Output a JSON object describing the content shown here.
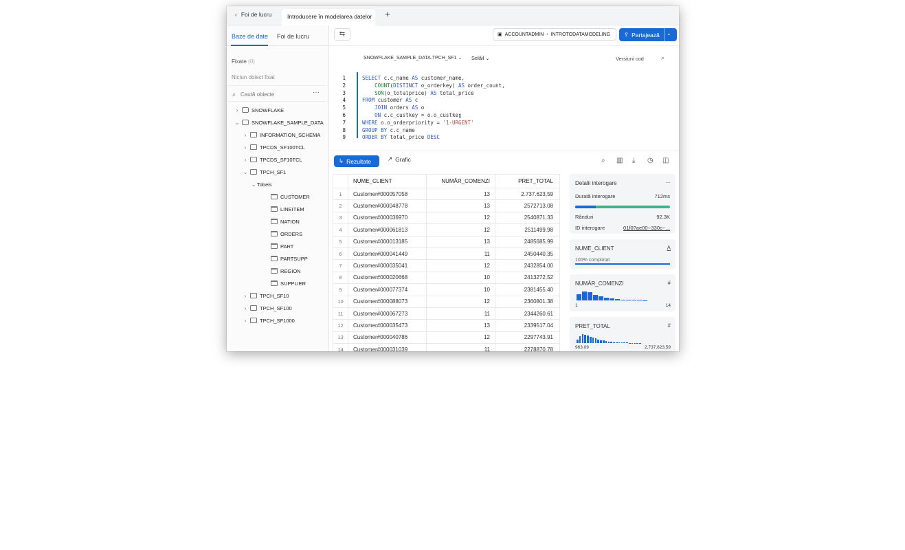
{
  "topbar": {
    "back_label": "Foi de lucru",
    "active_tab": "Introducere în modelarea datelor",
    "plus": "+"
  },
  "sidebar": {
    "tabs": [
      "Baze de date",
      "Foi de lucru"
    ],
    "pinned_label": "Fixate",
    "pinned_count": "(0)",
    "no_pinned": "Niciun obiect fixat",
    "search_placeholder": "Caută obiecte",
    "tree": [
      {
        "label": "SNOWFLAKE",
        "chev": "›",
        "icon": "db"
      },
      {
        "label": "SNOWFLAKE_SAMPLE_DATA",
        "chev": "⌄",
        "icon": "db"
      },
      {
        "label": "INFORMATION_SCHEMA",
        "chev": "›",
        "icon": "schema"
      },
      {
        "label": "TPCDS_SF100TCL",
        "chev": "›",
        "icon": "schema"
      },
      {
        "label": "TPCDS_SF10TCL",
        "chev": "›",
        "icon": "schema"
      },
      {
        "label": "TPCH_SF1",
        "chev": "⌄",
        "icon": "schema"
      },
      {
        "label": "Tobeis",
        "chev": "⌄",
        "icon": "none"
      },
      {
        "label": "CUSTOMER",
        "chev": "",
        "icon": "table"
      },
      {
        "label": "LINEITEM",
        "chev": "",
        "icon": "table"
      },
      {
        "label": "NATION",
        "chev": "",
        "icon": "table"
      },
      {
        "label": "ORDERS",
        "chev": "",
        "icon": "table"
      },
      {
        "label": "PART",
        "chev": "",
        "icon": "table"
      },
      {
        "label": "PARTSUPP",
        "chev": "",
        "icon": "table"
      },
      {
        "label": "REGION",
        "chev": "",
        "icon": "table"
      },
      {
        "label": "SUPPLIER",
        "chev": "",
        "icon": "table"
      },
      {
        "label": "TPCH_SF10",
        "chev": "›",
        "icon": "schema"
      },
      {
        "label": "TPCH_SF100",
        "chev": "›",
        "icon": "schema"
      },
      {
        "label": "TPCH_SF1000",
        "chev": "›",
        "icon": "schema"
      }
    ]
  },
  "toolbar": {
    "role": "ACCOUNTADMIN",
    "warehouse": "INTROTODATAMODELING",
    "share_label": "Partajează"
  },
  "context": {
    "database": "SNOWFLAKE_SAMPLE_DATA.TPCH_SF1",
    "selector": "Selăil",
    "versions": "Versiuni cod"
  },
  "editor": {
    "lines": [
      {
        "num": "1",
        "html": "<span class=\"kw\">SELECT</span> c.c_name <span class=\"kw\">AS</span> customer_name,"
      },
      {
        "num": "2",
        "html": "    <span class=\"fn\">COUNT</span>(<span class=\"kw\">DISTINCT</span> o_orderkey) <span class=\"kw\">AS</span> order_count,"
      },
      {
        "num": "3",
        "html": "    <span class=\"fn\">SON</span>(o_totalprice) <span class=\"kw\">AS</span> total_price"
      },
      {
        "num": "4",
        "html": "<span class=\"kw\">FROM</span> customer <span class=\"kw\">AS</span> c"
      },
      {
        "num": "5",
        "html": "    <span class=\"kw\">JOIN</span> orders <span class=\"kw\">AS</span> o"
      },
      {
        "num": "6",
        "html": "    <span class=\"kw\">ON</span> c.c_custkey = o.o_custkeɣ"
      },
      {
        "num": "7",
        "html": "<span class=\"kw\">WHERE</span> o.o_orderpriority = <span class=\"str\">'1-URGENT'</span>"
      },
      {
        "num": "8",
        "html": "<span class=\"kw\">GROUP BY</span> c.c_name"
      },
      {
        "num": "9",
        "html": "<span class=\"kw\">ORDER BY</span> total_price <span class=\"kw\">DESC</span>"
      }
    ]
  },
  "results": {
    "results_label": "Rezultate",
    "chart_label": "Grafic",
    "columns": [
      "NUME_CLIENT",
      "NUMĂR_COMENZI",
      "PRET_TOTAL"
    ],
    "rows": [
      [
        "1",
        "Customer#000057058",
        "13",
        "2.737.623,59"
      ],
      [
        "2",
        "Customer#000048778",
        "13",
        "2572713.08"
      ],
      [
        "3",
        "Customer#000036970",
        "12",
        "2540871.33"
      ],
      [
        "4",
        "Customer#000061813",
        "12",
        "2511499.98"
      ],
      [
        "5",
        "Customer#000013185",
        "13",
        "2485685.99"
      ],
      [
        "6",
        "Customer#000041449",
        "11",
        "2450440.35"
      ],
      [
        "7",
        "Customer#000035041",
        "12",
        "2432854.00"
      ],
      [
        "8",
        "Customer#000020668",
        "10",
        "2413272.52"
      ],
      [
        "9",
        "Customer#000077374",
        "10",
        "2381455.40"
      ],
      [
        "10",
        "Customer#000088073",
        "12",
        "2360801.38"
      ],
      [
        "11",
        "Customer#000067273",
        "11",
        "2344260.61"
      ],
      [
        "12",
        "Customer#000035473",
        "13",
        "2339517.04"
      ],
      [
        "13",
        "Customer#000040786",
        "12",
        "2297743.91"
      ],
      [
        "14",
        "Customer#000031039",
        "11",
        "2278870.78"
      ]
    ]
  },
  "details": {
    "title": "Detalii interogare",
    "duration_label": "Durată interogare",
    "duration_value": "712ms",
    "duration_fraction": 0.22,
    "rows_label": "Rânduri",
    "rows_value": "92.3K",
    "query_id_label": "ID interogare",
    "query_id_value": "01f0?ae00--330c--...",
    "col1_name": "NUME_CLIENT",
    "col1_type": "A",
    "col1_complete": "100% complotat",
    "col2_name": "NUMĂR_COMENZI",
    "col2_type": "#",
    "col2_min": "1",
    "col2_max": "14",
    "col2_hist": [
      0.5,
      0.7,
      0.65,
      0.45,
      0.35,
      0.2,
      0.15,
      0.1,
      0.08,
      0.05,
      0.04,
      0.03,
      0.02
    ],
    "col3_name": "PRET_TOTAL",
    "col3_type": "#",
    "col3_min": "963.09",
    "col3_max": "2,737,623.59",
    "col3_hist": [
      0.3,
      0.55,
      0.7,
      0.65,
      0.6,
      0.5,
      0.45,
      0.38,
      0.3,
      0.25,
      0.2,
      0.15,
      0.12,
      0.1,
      0.08,
      0.06,
      0.05,
      0.04,
      0.03,
      0.03,
      0.02,
      0.02,
      0.02,
      0.02,
      0.02
    ]
  }
}
